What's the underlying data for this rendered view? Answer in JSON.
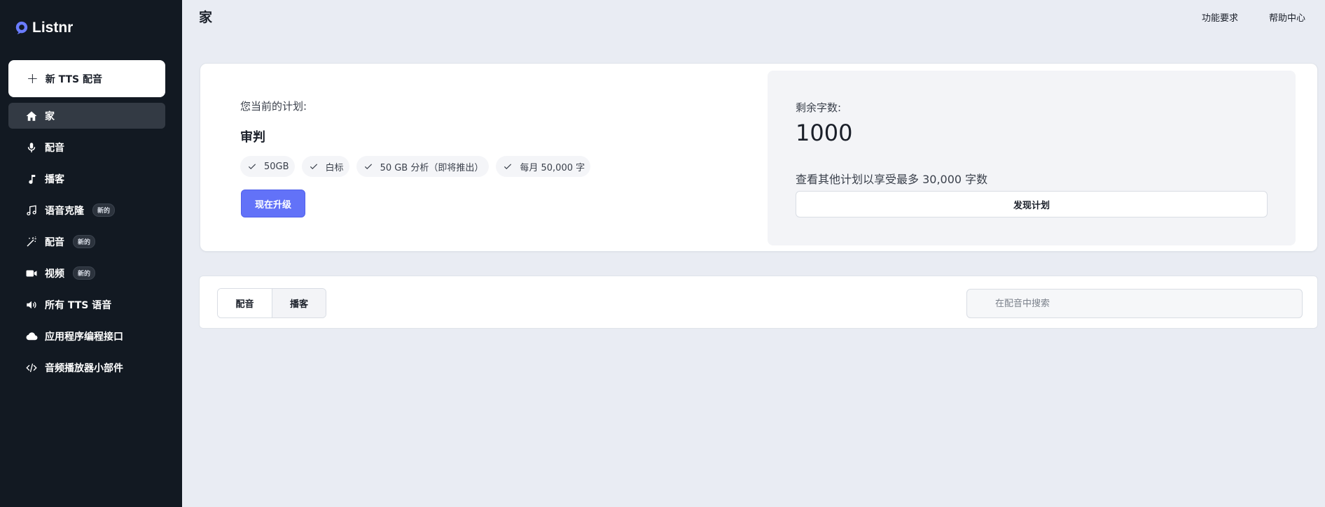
{
  "app": {
    "name": "Listnr"
  },
  "sidebar": {
    "new_button": "新 TTS 配音",
    "items": [
      {
        "label": "家",
        "icon": "home-icon",
        "active": true
      },
      {
        "label": "配音",
        "icon": "microphone-icon"
      },
      {
        "label": "播客",
        "icon": "music-note-icon"
      },
      {
        "label": "语音克隆",
        "icon": "music-notes-icon",
        "badge": "新的"
      },
      {
        "label": "配音",
        "icon": "magic-wand-icon",
        "badge": "新的"
      },
      {
        "label": "视频",
        "icon": "video-camera-icon",
        "badge": "新的"
      },
      {
        "label": "所有 TTS 语音",
        "icon": "speaker-icon"
      },
      {
        "label": "应用程序编程接口",
        "icon": "cloud-icon"
      },
      {
        "label": "音频播放器小部件",
        "icon": "code-icon"
      }
    ]
  },
  "header": {
    "title": "家",
    "links": [
      "功能要求",
      "帮助中心"
    ]
  },
  "plan": {
    "label": "您当前的计划:",
    "name": "审判",
    "features": [
      "50GB",
      "白标",
      "50 GB 分析（即将推出）",
      "每月 50,000 字"
    ],
    "upgrade_button": "现在升级"
  },
  "quota": {
    "label": "剩余字数:",
    "value": "1000",
    "hint": "查看其他计划以享受最多 30,000 字数",
    "discover_button": "发现计划"
  },
  "content": {
    "tabs": [
      "配音",
      "播客"
    ],
    "search_placeholder": "在配音中搜索"
  },
  "colors": {
    "sidebar_bg": "#121922",
    "page_bg": "#e9ecf3",
    "accent": "#6272f8"
  }
}
